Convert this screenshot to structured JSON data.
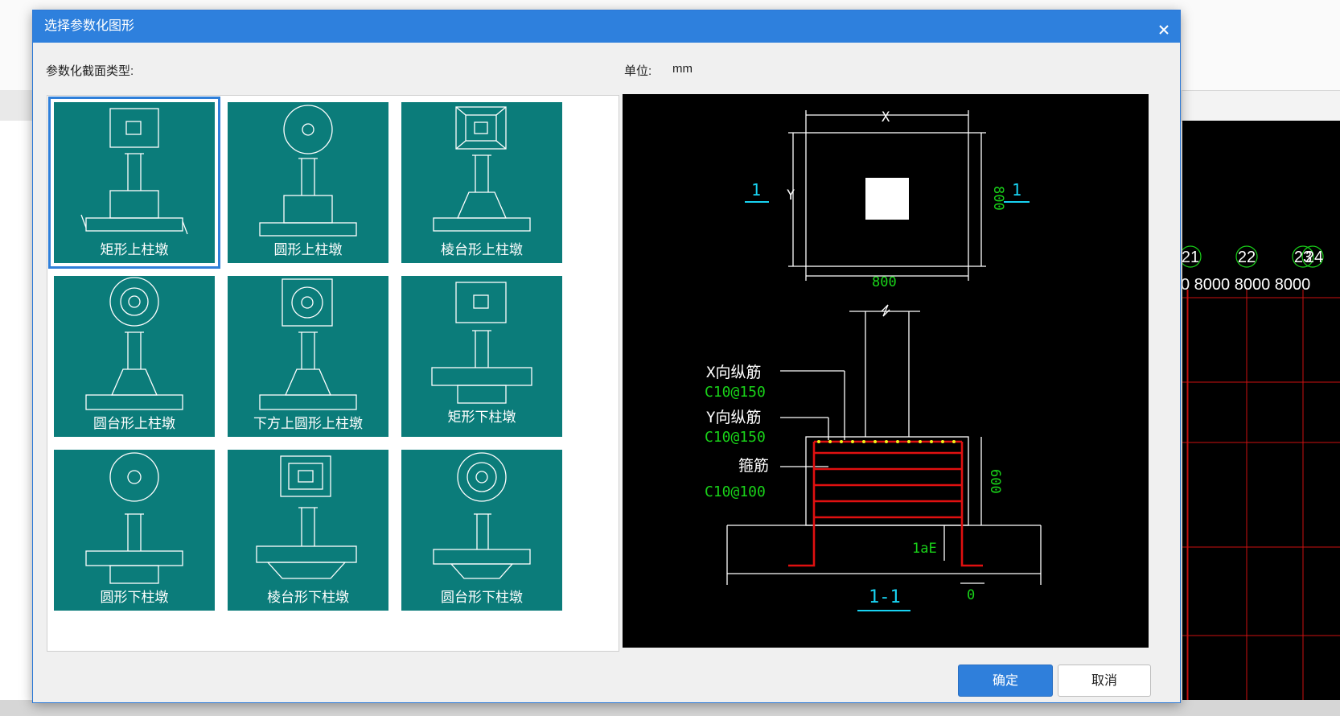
{
  "dialog": {
    "title": "选择参数化图形",
    "section_label": "参数化截面类型:",
    "unit_label": "单位:",
    "unit_value": "mm",
    "ok_label": "确定",
    "cancel_label": "取消"
  },
  "shapes": [
    {
      "label": "矩形上柱墩",
      "selected": true
    },
    {
      "label": "圆形上柱墩",
      "selected": false
    },
    {
      "label": "棱台形上柱墩",
      "selected": false
    },
    {
      "label": "圆台形上柱墩",
      "selected": false
    },
    {
      "label": "下方上圆形上柱墩",
      "selected": false
    },
    {
      "label": "矩形下柱墩",
      "selected": false
    },
    {
      "label": "圆形下柱墩",
      "selected": false
    },
    {
      "label": "棱台形下柱墩",
      "selected": false
    },
    {
      "label": "圆台形下柱墩",
      "selected": false
    }
  ],
  "preview": {
    "dim_x": "X",
    "dim_y": "Y",
    "dim_x_value": "800",
    "dim_y_value": "800",
    "section_mark_left": "1",
    "section_mark_right": "1",
    "label_x_bar": "X向纵筋",
    "value_x_bar": "C10@150",
    "label_y_bar": "Y向纵筋",
    "value_y_bar": "C10@150",
    "label_stirrup": "箍筋",
    "value_stirrup": "C10@100",
    "height_value": "600",
    "anchor_label": "1aE",
    "offset_value": "0",
    "section_title": "1-1"
  },
  "background": {
    "cad_axis_labels": [
      "21",
      "22",
      "23",
      "24"
    ],
    "cad_dims": "0 8000 8000 8000"
  },
  "colors": {
    "title_bar": "#2e80dd",
    "tile": "#0b7c7a",
    "selected_outline": "#2f7fd9",
    "cad_green": "#19d219",
    "cad_cyan": "#18d3f2",
    "cad_red": "#e01010",
    "cad_yellow": "#f2f21a"
  }
}
